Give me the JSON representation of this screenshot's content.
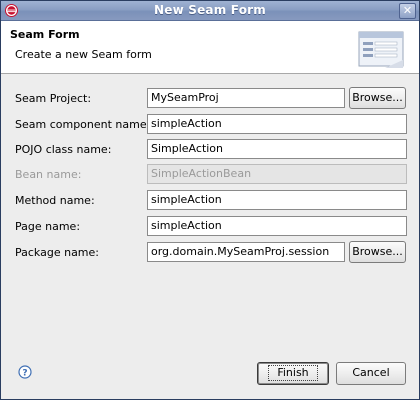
{
  "window": {
    "title": "New Seam Form"
  },
  "banner": {
    "title": "Seam Form",
    "message": "Create a new Seam form"
  },
  "form": {
    "fields": [
      {
        "label": "Seam Project:",
        "value": "MySeamProj",
        "enabled": true
      },
      {
        "label": "Seam component name:",
        "value": "simpleAction",
        "enabled": true
      },
      {
        "label": "POJO class name:",
        "value": "SimpleAction",
        "enabled": true
      },
      {
        "label": "Bean name:",
        "value": "SimpleActionBean",
        "enabled": false
      },
      {
        "label": "Method name:",
        "value": "simpleAction",
        "enabled": true
      },
      {
        "label": "Page name:",
        "value": "simpleAction",
        "enabled": true
      },
      {
        "label": "Package name:",
        "value": "org.domain.MySeamProj.session",
        "enabled": true
      }
    ],
    "browse_label": "Browse..."
  },
  "footer": {
    "finish_label": "Finish",
    "cancel_label": "Cancel"
  },
  "icons": {
    "app": "eclipse-icon",
    "close": "close-icon",
    "help": "help-icon",
    "banner": "form-wizard-icon"
  },
  "colors": {
    "titlebar": "#8a9ec3",
    "dialog_bg": "#ededed",
    "disabled_text": "#9a9a9a"
  }
}
